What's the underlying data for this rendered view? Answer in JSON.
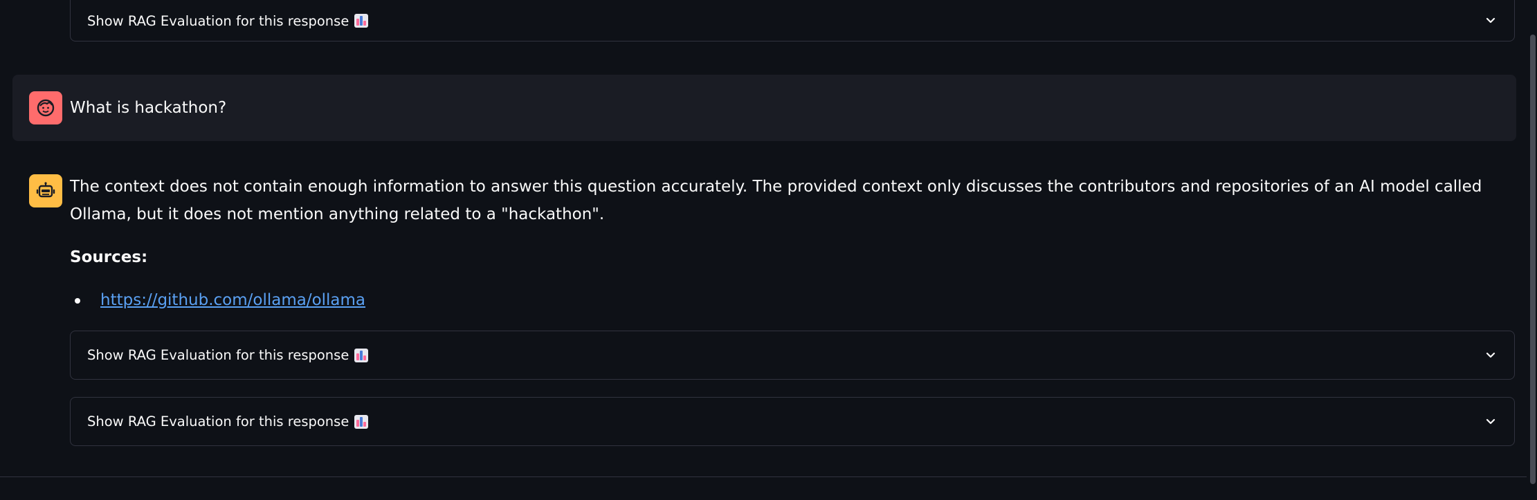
{
  "expanders": [
    {
      "label": "Show RAG Evaluation for this response",
      "emoji_icon": "bar-chart-emoji"
    },
    {
      "label": "Show RAG Evaluation for this response",
      "emoji_icon": "bar-chart-emoji"
    },
    {
      "label": "Show RAG Evaluation for this response",
      "emoji_icon": "bar-chart-emoji"
    }
  ],
  "user_message": {
    "avatar_icon": "user-face-icon",
    "avatar_color": "#ff6c6c",
    "text": "What is hackathon?"
  },
  "assistant_message": {
    "avatar_icon": "robot-icon",
    "avatar_color": "#ffbd45",
    "text": "The context does not contain enough information to answer this question accurately. The provided context only discusses the contributors and repositories of an AI model called Ollama, but it does not mention anything related to a \"hackathon\".",
    "sources_label": "Sources:",
    "sources": [
      {
        "url": "https://github.com/ollama/ollama"
      }
    ]
  },
  "colors": {
    "background": "#0e1117",
    "user_bubble": "#1a1c24",
    "link": "#5aa0f2"
  }
}
